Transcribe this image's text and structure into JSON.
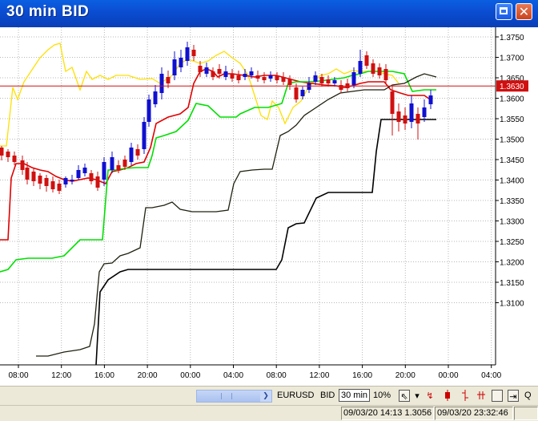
{
  "window": {
    "title": "30 min BID"
  },
  "chart": {
    "y_ticks": [
      "1.3750",
      "1.3700",
      "1.3650",
      "1.3600",
      "1.3550",
      "1.3500",
      "1.3450",
      "1.3400",
      "1.3350",
      "1.3300",
      "1.3250",
      "1.3200",
      "1.3150",
      "1.3100"
    ],
    "x_ticks": [
      "08:00",
      "12:00",
      "16:00",
      "20:00",
      "00:00",
      "04:00",
      "08:00",
      "12:00",
      "16:00",
      "20:00",
      "00:00",
      "04:00"
    ],
    "current_price": "1.3630",
    "colors": {
      "grid": "#b8b8b8",
      "price_line": "#d01010",
      "bull_candle": "#1010d0",
      "bear_candle": "#d01010",
      "kijun_yellow": "#ffe000",
      "tenkan_red": "#e00000",
      "green_line": "#00e000",
      "dark_olive": "#202010",
      "black": "#000000"
    }
  },
  "toolbar": {
    "symbol": "EURUSD",
    "side": "BID",
    "period": "30 min",
    "zoom": "10%",
    "icons": [
      "cursor-icon",
      "dropdown-arrow-icon",
      "trend-line-icon",
      "candlestick-icon",
      "ohlc-bar-icon",
      "exit-icon",
      "query-icon"
    ],
    "q_label": "Q"
  },
  "status": {
    "start": "09/03/20 14:13",
    "price": "1.3056",
    "end": "09/03/20 23:32:46"
  }
}
